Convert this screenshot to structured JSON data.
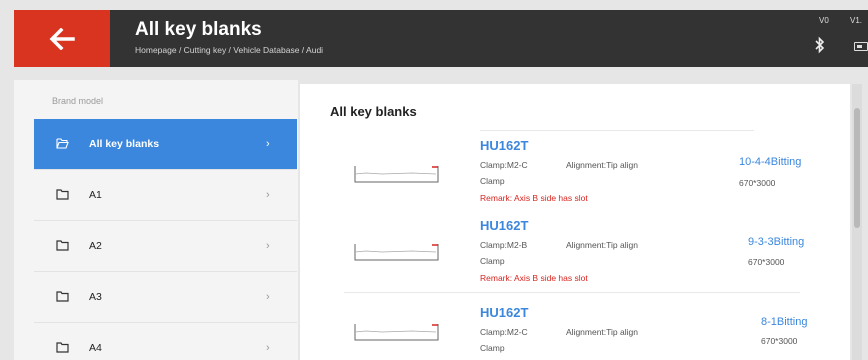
{
  "header": {
    "title": "All key blanks",
    "breadcrumb": "Homepage / Cutting key / Vehicle Database / Audi",
    "version_left": "V0",
    "version_right": "V1.",
    "back_icon": "arrow-left-icon",
    "bluetooth_icon": "bluetooth-icon",
    "battery_icon": "battery-icon",
    "accent_color": "#d8341f"
  },
  "sidebar": {
    "heading": "Brand model",
    "items": [
      {
        "label": "All key blanks",
        "icon": "folder-open-icon",
        "chevron": "›",
        "active": true
      },
      {
        "label": "A1",
        "icon": "folder-icon",
        "chevron": "›"
      },
      {
        "label": "A2",
        "icon": "folder-icon",
        "chevron": "›"
      },
      {
        "label": "A3",
        "icon": "folder-icon",
        "chevron": "›"
      },
      {
        "label": "A4",
        "icon": "folder-icon",
        "chevron": "›"
      }
    ],
    "active_color": "#3b87dd"
  },
  "main": {
    "title": "All key blanks",
    "keys": [
      {
        "name": "HU162T",
        "clamp": "Clamp:M2-C",
        "alignment": "Alignment:Tip align",
        "clamp_word": "Clamp",
        "remark": "Remark: Axis B side has slot",
        "bitting": "10-4-4Bitting",
        "size": "670*3000"
      },
      {
        "name": "HU162T",
        "clamp": "Clamp:M2-B",
        "alignment": "Alignment:Tip align",
        "clamp_word": "Clamp",
        "remark": "Remark: Axis B side has slot",
        "bitting": "9-3-3Bitting",
        "size": "670*3000"
      },
      {
        "name": "HU162T",
        "clamp": "Clamp:M2-C",
        "alignment": "Alignment:Tip align",
        "clamp_word": "Clamp",
        "bitting": "8-1Bitting",
        "size": "670*3000"
      }
    ]
  }
}
